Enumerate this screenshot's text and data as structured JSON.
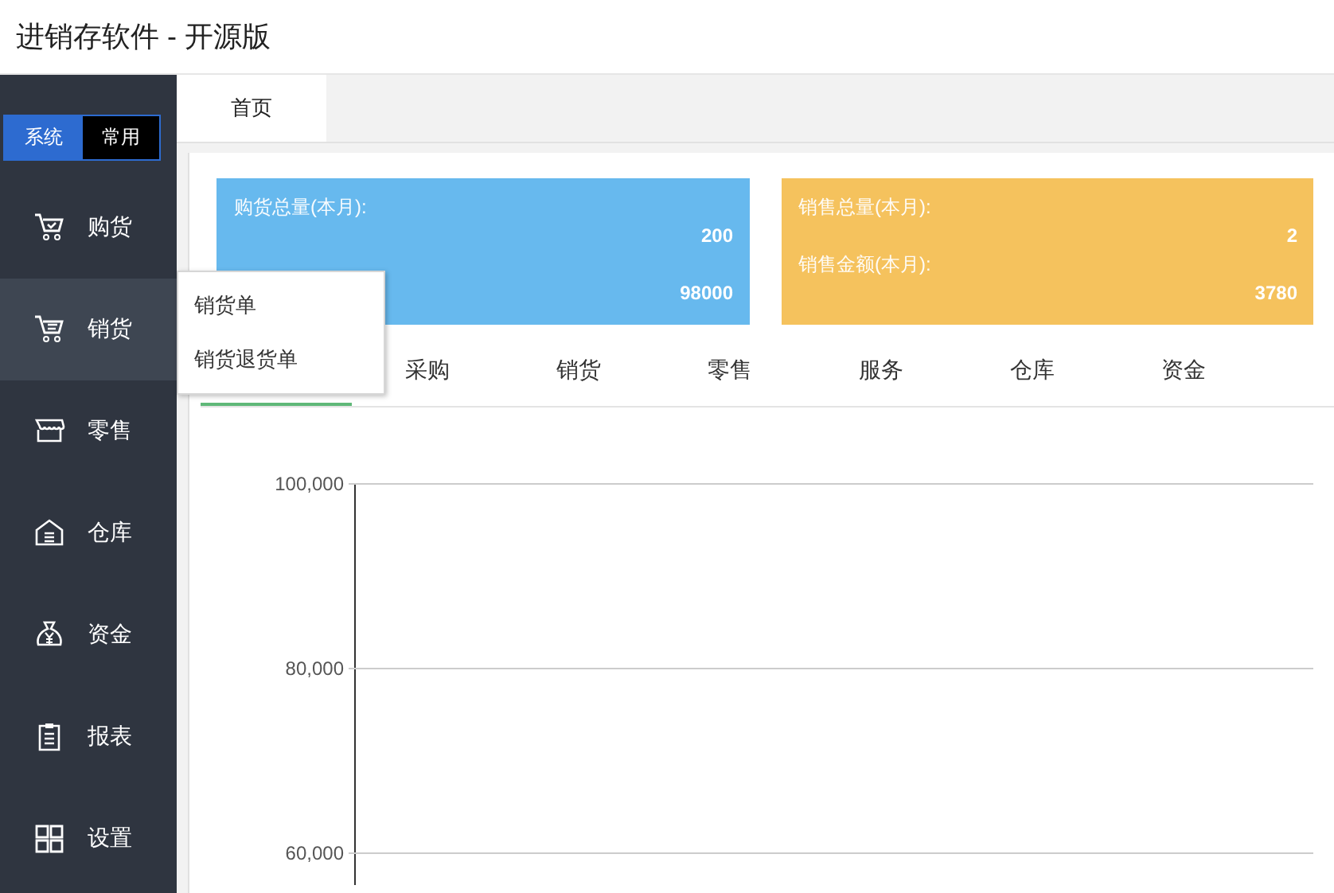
{
  "window": {
    "title": "进销存软件 - 开源版"
  },
  "sidebar": {
    "switch": [
      {
        "label": "系统",
        "selected": true
      },
      {
        "label": "常用",
        "selected": false
      }
    ],
    "items": [
      {
        "label": "购货",
        "selected": false
      },
      {
        "label": "销货",
        "selected": true,
        "submenu": [
          "销货单",
          "销货退货单"
        ]
      },
      {
        "label": "零售",
        "selected": false
      },
      {
        "label": "仓库",
        "selected": false
      },
      {
        "label": "资金",
        "selected": false
      },
      {
        "label": "报表",
        "selected": false
      },
      {
        "label": "设置",
        "selected": false
      }
    ]
  },
  "page_tabs": [
    {
      "label": "首页",
      "selected": true
    }
  ],
  "cards": [
    {
      "color": "#67b9ee",
      "rows": [
        {
          "label": "购货总量(本月):",
          "value": "200"
        },
        {
          "value": "98000"
        }
      ]
    },
    {
      "color": "#f5c25d",
      "rows": [
        {
          "label": "销售总量(本月):",
          "value": "2"
        },
        {
          "label": "销售金额(本月):",
          "value": "3780"
        }
      ]
    }
  ],
  "tabs": [
    {
      "selected": true
    },
    {
      "label": "采购",
      "selected": false
    },
    {
      "label": "销货",
      "selected": false
    },
    {
      "label": "零售",
      "selected": false
    },
    {
      "label": "服务",
      "selected": false
    },
    {
      "label": "仓库",
      "selected": false
    },
    {
      "label": "资金",
      "selected": false
    }
  ],
  "chart": {
    "y_axis_labels": [
      "100,000",
      "80,000",
      "60,000"
    ]
  }
}
